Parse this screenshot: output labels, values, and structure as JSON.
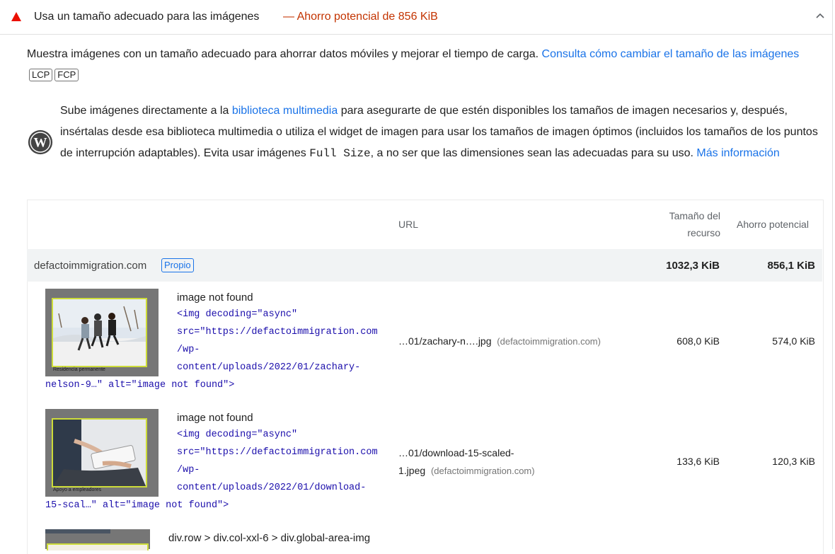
{
  "audit": {
    "title": "Usa un tamaño adecuado para las imágenes",
    "savings": "— Ahorro potencial de 856 KiB",
    "description": "Muestra imágenes con un tamaño adecuado para ahorrar datos móviles y mejorar el tiempo de carga.",
    "learn_link": "Consulta cómo cambiar el tamaño de las imágenes",
    "tags": [
      "LCP",
      "FCP"
    ]
  },
  "wp_tip": {
    "text_before": "Sube imágenes directamente a la",
    "link": "biblioteca multimedia",
    "text_middle": "para asegurarte de que estén disponibles los tamaños de imagen necesarios y, después, insértalas desde esa biblioteca multimedia o utiliza el widget de imagen para usar los tamaños de imagen óptimos (incluidos los tamaños de los puntos de interrupción adaptables). Evita usar imágenes",
    "code": "Full Size",
    "text_after": ", a no ser que las dimensiones sean las adecuadas para su uso.",
    "more_link": "Más información"
  },
  "table": {
    "headers": {
      "url": "URL",
      "size_line1": "Tamaño del",
      "size_line2": "recurso",
      "savings": "Ahorro potencial"
    },
    "group": {
      "name": "defactoimmigration.com",
      "badge": "Propio",
      "size": "1032,3 KiB",
      "savings": "856,1 KiB"
    },
    "rows": [
      {
        "label": "image not found",
        "code_lines": [
          "<img decoding=\"async\"",
          "src=\"https://defactoimmigration.com",
          "/wp-",
          "content/uploads/2022/01/zachary-"
        ],
        "code_last": "nelson-9…\" alt=\"image not found\">",
        "thumb_caption": "Residencia permanente",
        "url": "…01/zachary-n….jpg",
        "url_line2": "",
        "domain": "(defactoimmigration.com)",
        "size": "608,0 KiB",
        "savings": "574,0 KiB"
      },
      {
        "label": "image not found",
        "code_lines": [
          "<img decoding=\"async\"",
          "src=\"https://defactoimmigration.com",
          "/wp-",
          "content/uploads/2022/01/download-"
        ],
        "code_last": "15-scal…\" alt=\"image not found\">",
        "thumb_caption": "Apoyo a empleadores",
        "url": "…01/download-15-scaled-",
        "url_line2": "1.jpeg",
        "domain": "(defactoimmigration.com)",
        "size": "133,6 KiB",
        "savings": "120,3 KiB"
      }
    ],
    "row3_selector": "div.row > div.col-xxl-6 > div.global-area-img"
  },
  "colors": {
    "fail": "#eb0f00",
    "link": "#1a73e8",
    "code": "#1a0dab",
    "group_bg": "#f1f3f4"
  }
}
